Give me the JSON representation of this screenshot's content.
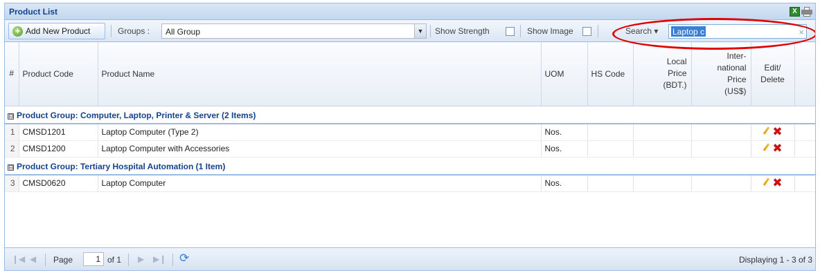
{
  "panel": {
    "title": "Product List"
  },
  "toolbar": {
    "add_label": "Add New Product",
    "groups_label": "Groups :",
    "groups_value": "All Group",
    "show_strength": "Show Strength",
    "show_image": "Show Image",
    "search_label": "Search ▾",
    "search_value": "Laptop c"
  },
  "columns": {
    "num": "#",
    "code": "Product Code",
    "name": "Product Name",
    "uom": "UOM",
    "hs": "HS Code",
    "local1": "Local",
    "local2": "Price",
    "local3": "(BDT.)",
    "intl1": "Inter-",
    "intl2": "national",
    "intl3": "Price",
    "intl4": "(US$)",
    "edit1": "Edit/",
    "edit2": "Delete"
  },
  "groups": [
    {
      "title": "Product Group: Computer, Laptop, Printer & Server (2 Items)",
      "rows": [
        {
          "num": "1",
          "code": "CMSD1201",
          "name": "Laptop Computer (Type 2)",
          "uom": "Nos."
        },
        {
          "num": "2",
          "code": "CMSD1200",
          "name": "Laptop Computer with Accessories",
          "uom": "Nos."
        }
      ]
    },
    {
      "title": "Product Group: Tertiary Hospital Automation (1 Item)",
      "rows": [
        {
          "num": "3",
          "code": "CMSD0620",
          "name": "Laptop Computer",
          "uom": "Nos."
        }
      ]
    }
  ],
  "pager": {
    "page_label": "Page",
    "page_value": "1",
    "of_label": "of 1",
    "display": "Displaying 1 - 3 of 3"
  },
  "icons": {
    "collapse": "⊟",
    "delete": "✖"
  },
  "colors": {
    "title": "#15428b",
    "annotation": "#e00000",
    "delete": "#cc1111",
    "selection": "#3d7fd4"
  }
}
